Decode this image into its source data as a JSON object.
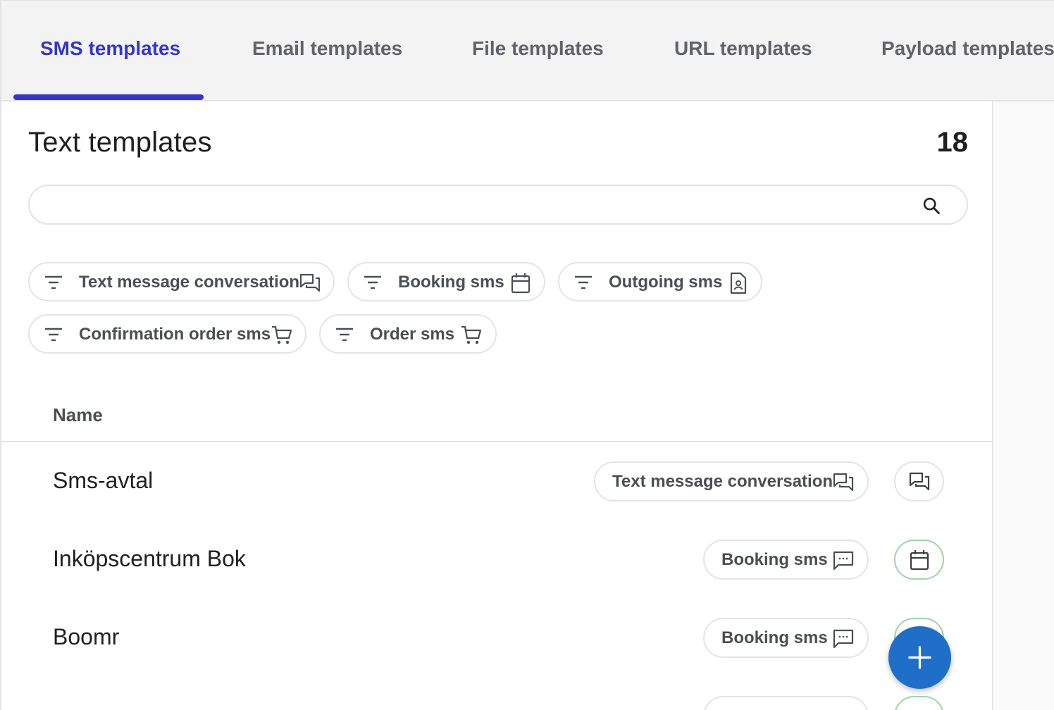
{
  "tabs": [
    {
      "label": "SMS templates",
      "active": true
    },
    {
      "label": "Email templates",
      "active": false
    },
    {
      "label": "File templates",
      "active": false
    },
    {
      "label": "URL templates",
      "active": false
    },
    {
      "label": "Payload templates",
      "active": false
    }
  ],
  "header": {
    "title": "Text templates",
    "count": "18"
  },
  "search": {
    "value": "",
    "placeholder": "",
    "icon": "search-icon"
  },
  "filters": [
    {
      "label": "Text message conversation",
      "icon": "forum-icon"
    },
    {
      "label": "Booking sms",
      "icon": "calendar-icon"
    },
    {
      "label": "Outgoing sms",
      "icon": "contact-file-icon"
    },
    {
      "label": "Confirmation order sms",
      "icon": "cart-icon"
    },
    {
      "label": "Order sms",
      "icon": "cart-icon"
    }
  ],
  "table": {
    "columns": [
      "Name"
    ],
    "rows": [
      {
        "name": "Sms-avtal",
        "tag": "Text message conversation",
        "tag_icon": "forum-icon",
        "action_icon": "forum-icon"
      },
      {
        "name": "Inköpscentrum Bok",
        "tag": "Booking sms",
        "tag_icon": "chat-dots-icon",
        "action_icon": "calendar-icon"
      },
      {
        "name": "Boomr",
        "tag": "Booking sms",
        "tag_icon": "chat-dots-icon",
        "action_icon": "calendar-icon"
      }
    ]
  },
  "fab": {
    "icon": "plus-icon"
  },
  "colors": {
    "accent": "#3535c9",
    "fab": "#1f6fc9",
    "success_border": "#9fd4a8",
    "text_muted": "#4a4f55"
  }
}
